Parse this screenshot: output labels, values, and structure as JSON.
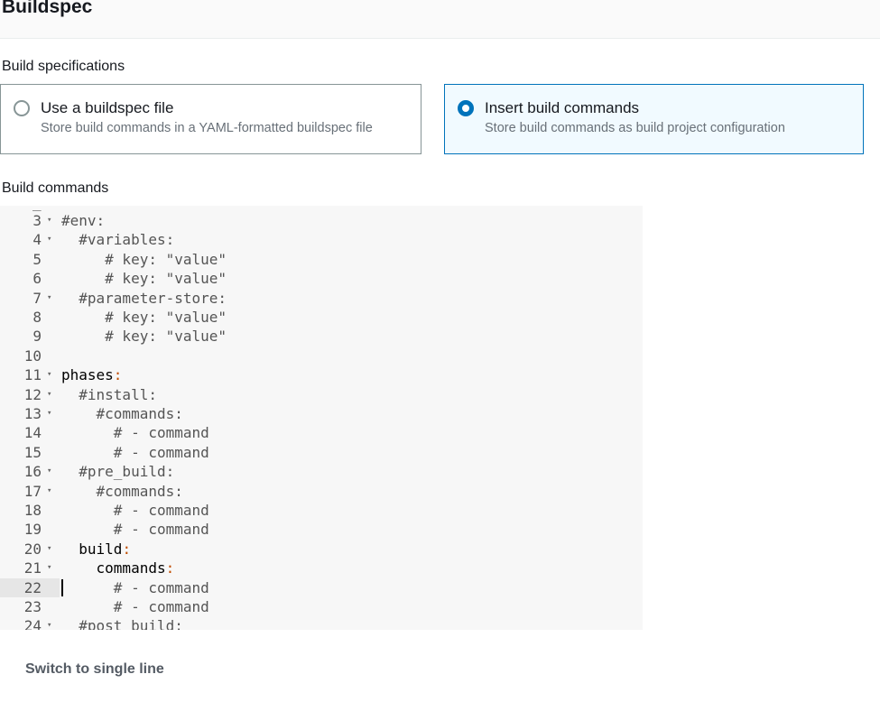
{
  "section": {
    "title": "Buildspec"
  },
  "build_specifications": {
    "label": "Build specifications",
    "options": [
      {
        "title": "Use a buildspec file",
        "description": "Store build commands in a YAML-formatted buildspec file",
        "selected": false
      },
      {
        "title": "Insert build commands",
        "description": "Store build commands as build project configuration",
        "selected": true
      }
    ]
  },
  "build_commands": {
    "label": "Build commands",
    "active_line": 22,
    "lines": [
      {
        "num": "3",
        "fold": true,
        "indent": "",
        "text": "#env:",
        "kind": "comment"
      },
      {
        "num": "4",
        "fold": true,
        "indent": "  ",
        "text": "#variables:",
        "kind": "comment"
      },
      {
        "num": "5",
        "fold": false,
        "indent": "     ",
        "text": "# key: \"value\"",
        "kind": "comment"
      },
      {
        "num": "6",
        "fold": false,
        "indent": "     ",
        "text": "# key: \"value\"",
        "kind": "comment"
      },
      {
        "num": "7",
        "fold": true,
        "indent": "  ",
        "text": "#parameter-store:",
        "kind": "comment"
      },
      {
        "num": "8",
        "fold": false,
        "indent": "     ",
        "text": "# key: \"value\"",
        "kind": "comment"
      },
      {
        "num": "9",
        "fold": false,
        "indent": "     ",
        "text": "# key: \"value\"",
        "kind": "comment"
      },
      {
        "num": "10",
        "fold": false,
        "indent": "",
        "text": "",
        "kind": "blank"
      },
      {
        "num": "11",
        "fold": true,
        "indent": "",
        "text": "phases",
        "kind": "key"
      },
      {
        "num": "12",
        "fold": true,
        "indent": "  ",
        "text": "#install:",
        "kind": "comment"
      },
      {
        "num": "13",
        "fold": true,
        "indent": "    ",
        "text": "#commands:",
        "kind": "comment"
      },
      {
        "num": "14",
        "fold": false,
        "indent": "      ",
        "text": "# - command",
        "kind": "comment"
      },
      {
        "num": "15",
        "fold": false,
        "indent": "      ",
        "text": "# - command",
        "kind": "comment"
      },
      {
        "num": "16",
        "fold": true,
        "indent": "  ",
        "text": "#pre_build:",
        "kind": "comment"
      },
      {
        "num": "17",
        "fold": true,
        "indent": "    ",
        "text": "#commands:",
        "kind": "comment"
      },
      {
        "num": "18",
        "fold": false,
        "indent": "      ",
        "text": "# - command",
        "kind": "comment"
      },
      {
        "num": "19",
        "fold": false,
        "indent": "      ",
        "text": "# - command",
        "kind": "comment"
      },
      {
        "num": "20",
        "fold": true,
        "indent": "  ",
        "text": "build",
        "kind": "key"
      },
      {
        "num": "21",
        "fold": true,
        "indent": "    ",
        "text": "commands",
        "kind": "key"
      },
      {
        "num": "22",
        "fold": false,
        "indent": "      ",
        "text": "# - command",
        "kind": "comment"
      },
      {
        "num": "23",
        "fold": false,
        "indent": "      ",
        "text": "# - command",
        "kind": "comment"
      },
      {
        "num": "24",
        "fold": true,
        "indent": "  ",
        "text": "#post_build:",
        "kind": "comment"
      }
    ]
  },
  "switch_link": {
    "label": "Switch to single line"
  },
  "colors": {
    "accent": "#0073bb",
    "yaml_colon": "#c24e00"
  }
}
